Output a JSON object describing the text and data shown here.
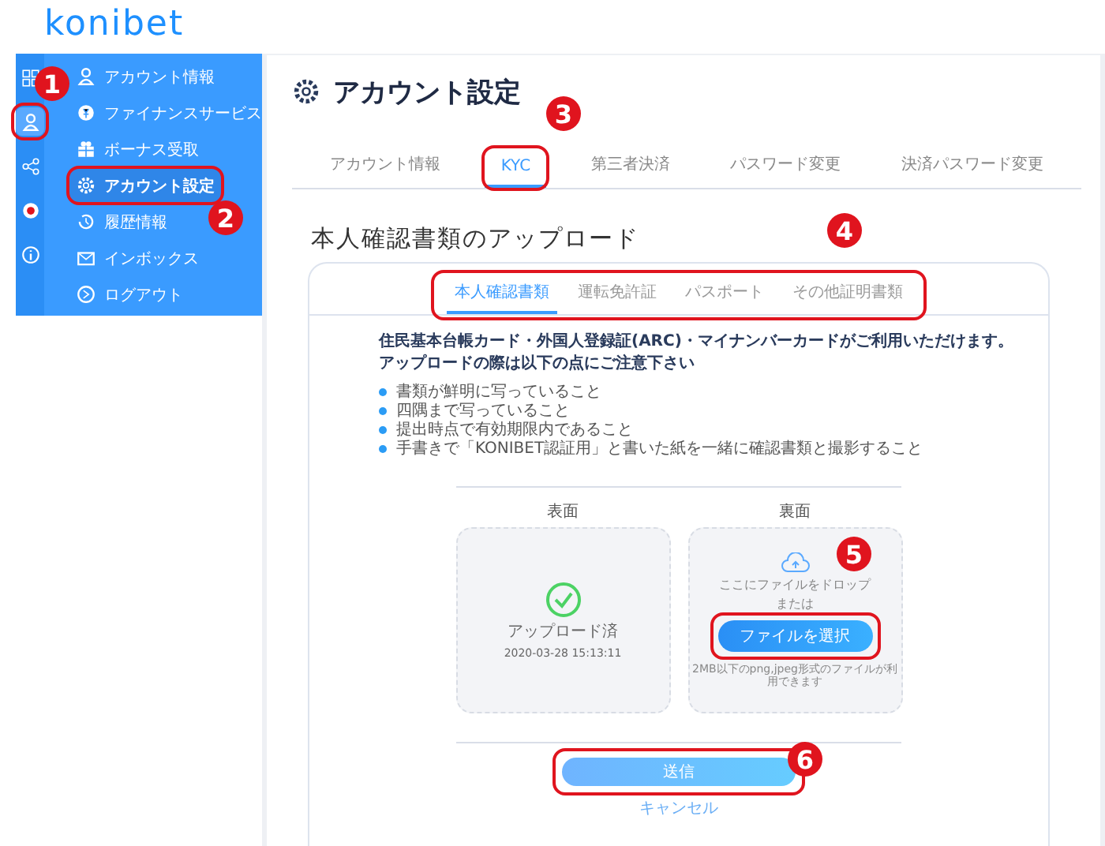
{
  "logo": {
    "text": "konibet"
  },
  "rail": [
    {
      "kind": "grid",
      "selected": false
    },
    {
      "kind": "user",
      "selected": true
    },
    {
      "kind": "share",
      "selected": false
    },
    {
      "kind": "record",
      "selected": false
    },
    {
      "kind": "info",
      "selected": false
    }
  ],
  "menu": [
    {
      "kind": "user",
      "label": "アカウント情報",
      "selected": false
    },
    {
      "kind": "finance",
      "label": "ファイナンスサービス",
      "selected": false
    },
    {
      "kind": "gift",
      "label": "ボーナス受取",
      "selected": false
    },
    {
      "kind": "gear",
      "label": "アカウント設定",
      "selected": true
    },
    {
      "kind": "history",
      "label": "履歴情報",
      "selected": false
    },
    {
      "kind": "mail",
      "label": "インボックス",
      "selected": false
    },
    {
      "kind": "logout",
      "label": "ログアウト",
      "selected": false
    }
  ],
  "page": {
    "title": "アカウント設定"
  },
  "tabs": [
    {
      "label": "アカウント情報",
      "selected": false
    },
    {
      "label": "KYC",
      "selected": true
    },
    {
      "label": "第三者決済",
      "selected": false
    },
    {
      "label": "パスワード変更",
      "selected": false
    },
    {
      "label": "決済パスワード変更",
      "selected": false
    }
  ],
  "section": {
    "title": "本人確認書類のアップロード"
  },
  "doc_tabs": [
    {
      "label": "本人確認書類",
      "selected": true
    },
    {
      "label": "運転免許証",
      "selected": false
    },
    {
      "label": "パスポート",
      "selected": false
    },
    {
      "label": "その他証明書類",
      "selected": false
    }
  ],
  "intro": [
    "住民基本台帳カード・外国人登録証(ARC)・マイナンバーカードがご利用いただけます。",
    "アップロードの際は以下の点にご注意下さい"
  ],
  "notes": [
    "書類が鮮明に写っていること",
    "四隅まで写っていること",
    "提出時点で有効期限内であること",
    "手書きで「KONIBET認証用」と書いた紙を一緒に確認書類と撮影すること"
  ],
  "uploads": [
    {
      "label": "表面",
      "uploaded": true,
      "status": "アップロード済",
      "time": "2020-03-28 15:13:11"
    },
    {
      "label": "裏面",
      "uploaded": false,
      "drop_text": "ここにファイルをドロップ",
      "or_text": "または",
      "button": "ファイルを選択",
      "hint": "2MB以下のpng,jpeg形式のファイルが利用できます"
    }
  ],
  "submit": {
    "label": "送信"
  },
  "cancel": {
    "label": "キャンセル"
  },
  "annotations": [
    "1",
    "2",
    "3",
    "4",
    "5",
    "6"
  ]
}
